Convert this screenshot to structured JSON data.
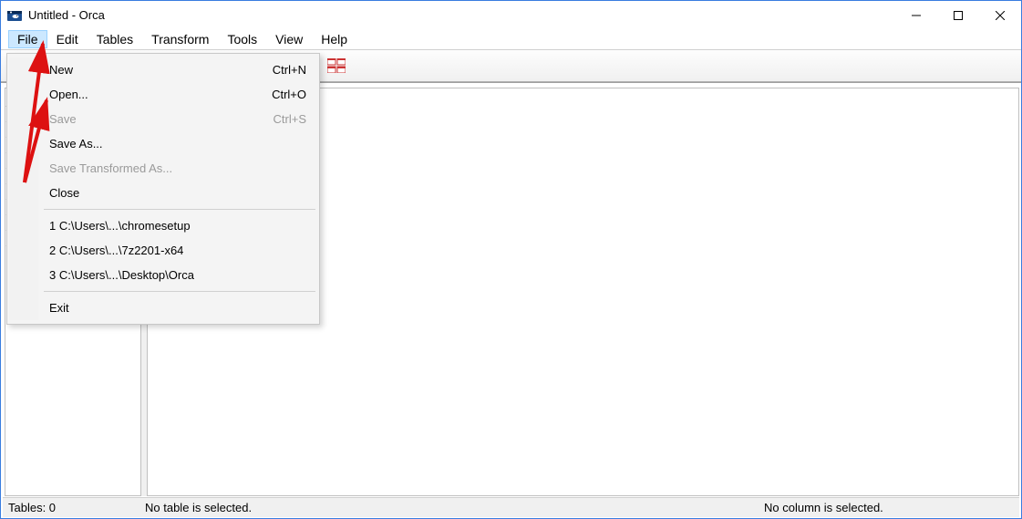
{
  "window": {
    "title": "Untitled - Orca"
  },
  "menubar": {
    "items": [
      "File",
      "Edit",
      "Tables",
      "Transform",
      "Tools",
      "View",
      "Help"
    ]
  },
  "file_menu": {
    "new": {
      "label": "New",
      "shortcut": "Ctrl+N"
    },
    "open": {
      "label": "Open...",
      "shortcut": "Ctrl+O"
    },
    "save": {
      "label": "Save",
      "shortcut": "Ctrl+S"
    },
    "save_as": {
      "label": "Save As..."
    },
    "save_transformed_as": {
      "label": "Save Transformed As..."
    },
    "close": {
      "label": "Close"
    },
    "recent": [
      "1 C:\\Users\\...\\chromesetup",
      "2 C:\\Users\\...\\7z2201-x64",
      "3 C:\\Users\\...\\Desktop\\Orca"
    ],
    "exit": {
      "label": "Exit"
    }
  },
  "statusbar": {
    "tables": "Tables: 0",
    "table_sel": "No table is selected.",
    "column_sel": "No column is selected."
  }
}
